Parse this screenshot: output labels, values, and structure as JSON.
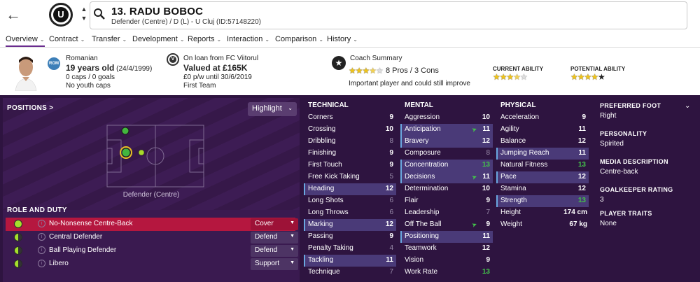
{
  "header": {
    "player_name": "13. RADU BOBOC",
    "subtitle": "Defender (Centre) / D (L) - U Cluj (ID:57148220)",
    "club_badge_letter": "U"
  },
  "tabs": [
    {
      "label": "Overview"
    },
    {
      "label": "Contract"
    },
    {
      "label": "Transfer"
    },
    {
      "label": "Development"
    },
    {
      "label": "Reports"
    },
    {
      "label": "Interaction"
    },
    {
      "label": "Comparison"
    },
    {
      "label": "History"
    }
  ],
  "summary": {
    "nationality": "Romanian",
    "nation_code": "ROM",
    "age": "19 years old",
    "dob": "(24/4/1999)",
    "caps": "0 caps / 0 goals",
    "youth_caps": "No youth caps",
    "loan_from": "On loan from FC Viitorul",
    "value": "Valued at £165K",
    "wage": "£0 p/w until 30/6/2019",
    "squad": "First Team",
    "coach_title": "Coach Summary",
    "coach_pros": "8 Pros / 3 Cons",
    "coach_note": "Important player and could still improve",
    "coach_stars": 3.5,
    "current_ability_label": "CURRENT ABILITY",
    "current_ability_stars": 3.5,
    "potential_ability_label": "POTENTIAL ABILITY",
    "potential_ability_stars": 4
  },
  "positions": {
    "title": "POSITIONS >",
    "highlight": "Highlight",
    "label": "Defender (Centre)"
  },
  "role_duty": {
    "title": "ROLE AND DUTY",
    "rows": [
      {
        "role": "No-Nonsense Centre-Back",
        "duty": "Cover",
        "dot": "full"
      },
      {
        "role": "Central Defender",
        "duty": "Defend",
        "dot": "half"
      },
      {
        "role": "Ball Playing Defender",
        "duty": "Defend",
        "dot": "half"
      },
      {
        "role": "Libero",
        "duty": "Support",
        "dot": "half"
      }
    ]
  },
  "technical": {
    "title": "TECHNICAL",
    "rows": [
      {
        "name": "Corners",
        "value": "9",
        "style": "",
        "hl": false
      },
      {
        "name": "Crossing",
        "value": "10",
        "style": "",
        "hl": false
      },
      {
        "name": "Dribbling",
        "value": "8",
        "style": "mid",
        "hl": false
      },
      {
        "name": "Finishing",
        "value": "9",
        "style": "",
        "hl": false
      },
      {
        "name": "First Touch",
        "value": "9",
        "style": "",
        "hl": false
      },
      {
        "name": "Free Kick Taking",
        "value": "5",
        "style": "mid",
        "hl": false
      },
      {
        "name": "Heading",
        "value": "12",
        "style": "",
        "hl": true
      },
      {
        "name": "Long Shots",
        "value": "6",
        "style": "mid",
        "hl": false
      },
      {
        "name": "Long Throws",
        "value": "6",
        "style": "mid",
        "hl": false
      },
      {
        "name": "Marking",
        "value": "12",
        "style": "",
        "hl": true
      },
      {
        "name": "Passing",
        "value": "9",
        "style": "",
        "hl": false
      },
      {
        "name": "Penalty Taking",
        "value": "4",
        "style": "mid",
        "hl": false
      },
      {
        "name": "Tackling",
        "value": "11",
        "style": "",
        "hl": true
      },
      {
        "name": "Technique",
        "value": "7",
        "style": "mid",
        "hl": false
      }
    ]
  },
  "mental": {
    "title": "MENTAL",
    "rows": [
      {
        "name": "Aggression",
        "value": "10",
        "style": "",
        "hl": false,
        "trend": false
      },
      {
        "name": "Anticipation",
        "value": "11",
        "style": "",
        "hl": true,
        "trend": true
      },
      {
        "name": "Bravery",
        "value": "12",
        "style": "",
        "hl": true,
        "trend": false
      },
      {
        "name": "Composure",
        "value": "8",
        "style": "mid",
        "hl": false,
        "trend": false
      },
      {
        "name": "Concentration",
        "value": "13",
        "style": "good",
        "hl": true,
        "trend": false
      },
      {
        "name": "Decisions",
        "value": "11",
        "style": "",
        "hl": true,
        "trend": true
      },
      {
        "name": "Determination",
        "value": "10",
        "style": "",
        "hl": false,
        "trend": false
      },
      {
        "name": "Flair",
        "value": "9",
        "style": "",
        "hl": false,
        "trend": false
      },
      {
        "name": "Leadership",
        "value": "7",
        "style": "mid",
        "hl": false,
        "trend": false
      },
      {
        "name": "Off The Ball",
        "value": "9",
        "style": "",
        "hl": false,
        "trend": true
      },
      {
        "name": "Positioning",
        "value": "11",
        "style": "",
        "hl": true,
        "trend": false
      },
      {
        "name": "Teamwork",
        "value": "12",
        "style": "",
        "hl": false,
        "trend": false
      },
      {
        "name": "Vision",
        "value": "9",
        "style": "",
        "hl": false,
        "trend": false
      },
      {
        "name": "Work Rate",
        "value": "13",
        "style": "good",
        "hl": false,
        "trend": false
      }
    ]
  },
  "physical": {
    "title": "PHYSICAL",
    "rows": [
      {
        "name": "Acceleration",
        "value": "9",
        "style": "",
        "hl": false
      },
      {
        "name": "Agility",
        "value": "11",
        "style": "",
        "hl": false
      },
      {
        "name": "Balance",
        "value": "12",
        "style": "",
        "hl": false
      },
      {
        "name": "Jumping Reach",
        "value": "11",
        "style": "",
        "hl": true
      },
      {
        "name": "Natural Fitness",
        "value": "13",
        "style": "good",
        "hl": false
      },
      {
        "name": "Pace",
        "value": "12",
        "style": "",
        "hl": true
      },
      {
        "name": "Stamina",
        "value": "12",
        "style": "",
        "hl": false
      },
      {
        "name": "Strength",
        "value": "13",
        "style": "good",
        "hl": true
      }
    ],
    "height_label": "Height",
    "height_value": "174 cm",
    "weight_label": "Weight",
    "weight_value": "67 kg"
  },
  "info": {
    "preferred_foot_label": "PREFERRED FOOT",
    "preferred_foot": "Right",
    "personality_label": "PERSONALITY",
    "personality": "Spirited",
    "media_label": "MEDIA DESCRIPTION",
    "media": "Centre-back",
    "gk_label": "GOALKEEPER RATING",
    "gk": "3",
    "traits_label": "PLAYER TRAITS",
    "traits": "None"
  }
}
